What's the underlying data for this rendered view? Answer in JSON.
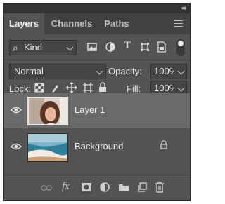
{
  "tabs": [
    {
      "label": "Layers",
      "active": true
    },
    {
      "label": "Channels",
      "active": false
    },
    {
      "label": "Paths",
      "active": false
    }
  ],
  "filter": {
    "kind_label": "Kind",
    "search_glyph": "⌕"
  },
  "filter_icons": [
    "image-filter-icon",
    "adjustment-filter-icon",
    "type-filter-icon",
    "shape-filter-icon",
    "smartobject-filter-icon"
  ],
  "blend": {
    "mode": "Normal",
    "opacity_label": "Opacity:",
    "opacity_value": "100%"
  },
  "lock": {
    "label": "Lock:",
    "fill_label": "Fill:",
    "fill_value": "100%"
  },
  "type_glyph": "T",
  "layers": [
    {
      "name": "Layer 1",
      "selected": true,
      "locked": false
    },
    {
      "name": "Background",
      "selected": false,
      "locked": true
    }
  ],
  "bottom_icons": [
    "link-icon",
    "fx-icon",
    "mask-icon",
    "adjustment-layer-icon",
    "group-folder-icon",
    "new-layer-icon",
    "trash-icon"
  ],
  "fx_glyph": "fx",
  "colors": {
    "panel": "#535353",
    "tabbar": "#424242",
    "selected_row": "#6a6a6a",
    "field": "#454545"
  }
}
